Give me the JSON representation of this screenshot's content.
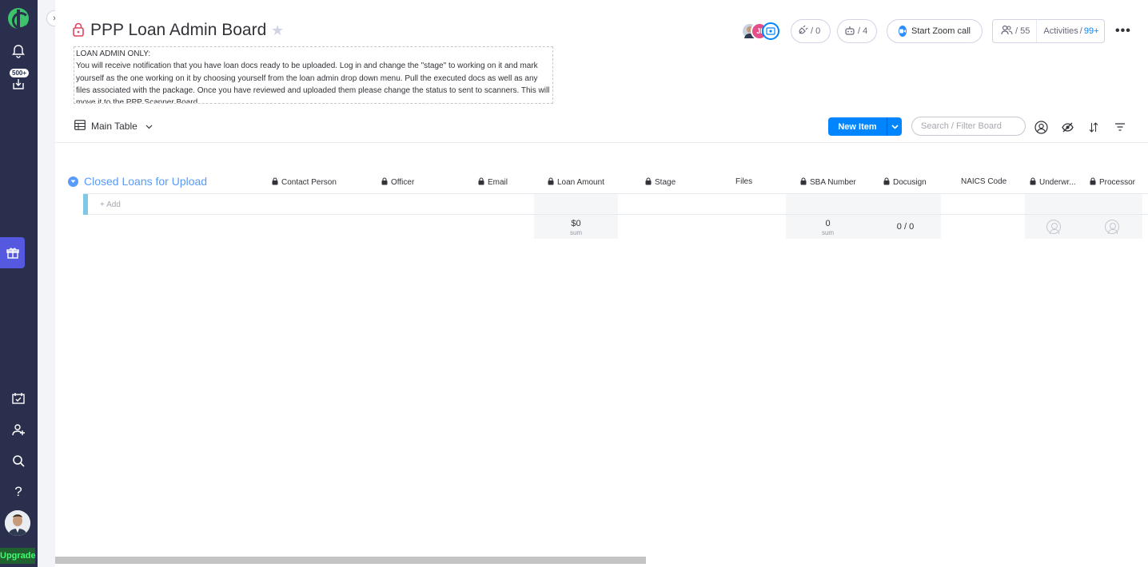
{
  "sidebar": {
    "badge": "500+",
    "upgrade_label": "Upgrade"
  },
  "header": {
    "title": "PPP Loan Admin Board",
    "description": "LOAN ADMIN ONLY:\nYou will receive notification that you have loan docs ready to be uploaded. Log in and change the \"stage\" to working on it and mark yourself as the one working on it by choosing yourself from the loan admin drop down menu. Pull the executed docs as well as any files associated with the package. Once you have reviewed and uploaded them please change the status to sent to scanners. This will move it to the PPP Scanner Board.",
    "avatar_initials": "JI",
    "integrations_count": "/ 0",
    "automations_count": "/ 4",
    "zoom_label": "Start Zoom call",
    "members_count": "/ 55",
    "activities_label": "Activities",
    "activities_count": "99+"
  },
  "toolbar": {
    "view_label": "Main Table",
    "new_item_label": "New Item",
    "search_placeholder": "Search / Filter Board"
  },
  "group": {
    "title": "Closed Loans for Upload",
    "color": "#579bfc",
    "add_label": "+ Add",
    "columns": [
      "Contact Person",
      "Officer",
      "Email",
      "Loan Amount",
      "Stage",
      "Files",
      "SBA Number",
      "Docusign",
      "NAICS Code",
      "Underwr...",
      "Processor"
    ],
    "summary": {
      "loan_amount": "$0",
      "loan_amount_sub": "sum",
      "sba_number": "0",
      "sba_number_sub": "sum",
      "docusign": "0 / 0"
    }
  },
  "colors": {
    "accent": "#0085ff",
    "sidebar": "#292f4c",
    "upgrade": "#3cff6c"
  }
}
